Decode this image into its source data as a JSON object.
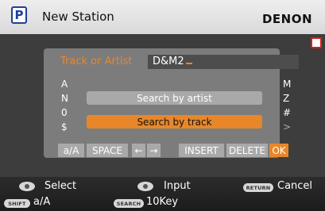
{
  "header": {
    "p_icon_letter": "P",
    "title": "New Station",
    "brand": "DENON"
  },
  "input": {
    "label": "Track or Artist",
    "value": "D&M2"
  },
  "char_list": {
    "left": [
      "A",
      "N",
      "0",
      "$"
    ],
    "right": [
      "M",
      "Z",
      "#",
      ">"
    ]
  },
  "options": {
    "artist": "Search by artist",
    "track": "Search by track",
    "selected": "track"
  },
  "keys": [
    {
      "label": "a/A"
    },
    {
      "label": "SPACE"
    },
    {
      "label": "←"
    },
    {
      "label": "→"
    },
    {
      "label": "INSERT"
    },
    {
      "label": "DELETE"
    },
    {
      "label": "OK"
    }
  ],
  "footer": {
    "select": "Select",
    "input": "Input",
    "return_btn": "RETURN",
    "cancel": "Cancel",
    "shift_btn": "SHIFT",
    "shift_label": "a/A",
    "search_btn": "SEARCH",
    "search_label": "10Key"
  },
  "colors": {
    "accent": "#e8872a",
    "header_bg": "#e6e6e6",
    "screen_bg": "#3d3d3d",
    "panel_bg": "#7c7c7c",
    "rec": "#d62015"
  }
}
